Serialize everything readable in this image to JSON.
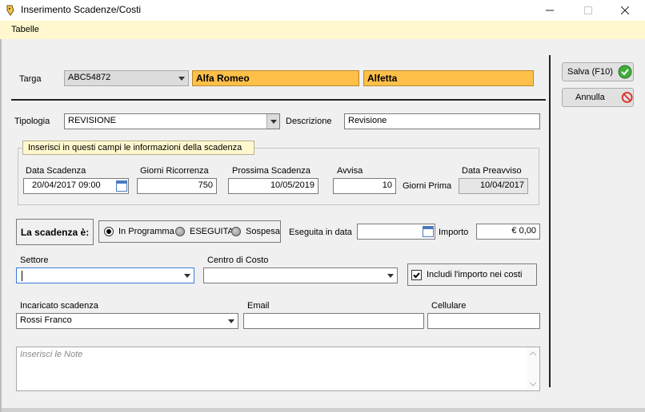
{
  "window": {
    "title": "Inserimento Scadenze/Costi",
    "minimize_icon": "minimize-icon",
    "maximize_icon": "maximize-icon",
    "close_icon": "close-icon"
  },
  "menu": {
    "items": [
      "Tabelle"
    ]
  },
  "vehicle": {
    "targa_label": "Targa",
    "targa_value": "ABC54872",
    "make": "Alfa Romeo",
    "model": "Alfetta"
  },
  "tipologia": {
    "label": "Tipologia",
    "value": "REVISIONE",
    "descrizione_label": "Descrizione",
    "descrizione_value": "Revisione"
  },
  "scadenza_group": {
    "hint": "Inserisci in questi campi le informazioni della scadenza",
    "data_scadenza_label": "Data Scadenza",
    "data_scadenza_value": "20/04/2017 09:00",
    "giorni_ricorrenza_label": "Giorni Ricorrenza",
    "giorni_ricorrenza_value": "750",
    "prossima_scadenza_label": "Prossima Scadenza",
    "prossima_scadenza_value": "10/05/2019",
    "avvisa_label": "Avvisa",
    "avvisa_value": "10",
    "giorni_prima_label": "Giorni Prima",
    "data_preavviso_label": "Data Preavviso",
    "data_preavviso_value": "10/04/2017"
  },
  "stato": {
    "label": "La scadenza è:",
    "options": [
      {
        "label": "In Programma",
        "selected": true
      },
      {
        "label": "ESEGUITA",
        "selected": false
      },
      {
        "label": "Sospesa",
        "selected": false
      }
    ],
    "eseguita_label": "Eseguita in data",
    "eseguita_value": "",
    "importo_label": "Importo",
    "importo_value": "€ 0,00"
  },
  "settore": {
    "label": "Settore",
    "value": ""
  },
  "centro_costo": {
    "label": "Centro di Costo",
    "value": ""
  },
  "includi": {
    "label": "Includi l'importo nei costi",
    "checked": true
  },
  "incaricato": {
    "label": "Incaricato scadenza",
    "value": "Rossi Franco"
  },
  "email": {
    "label": "Email",
    "value": ""
  },
  "cellulare": {
    "label": "Cellulare",
    "value": ""
  },
  "note": {
    "placeholder": "Inserisci le Note"
  },
  "actions": {
    "save_label": "Salva (F10)",
    "cancel_label": "Annulla"
  },
  "colors": {
    "accent_orange": "#ffc04a",
    "menubar": "#fff8cf",
    "save_green": "#3fae3a",
    "cancel_red": "#d9342b"
  }
}
